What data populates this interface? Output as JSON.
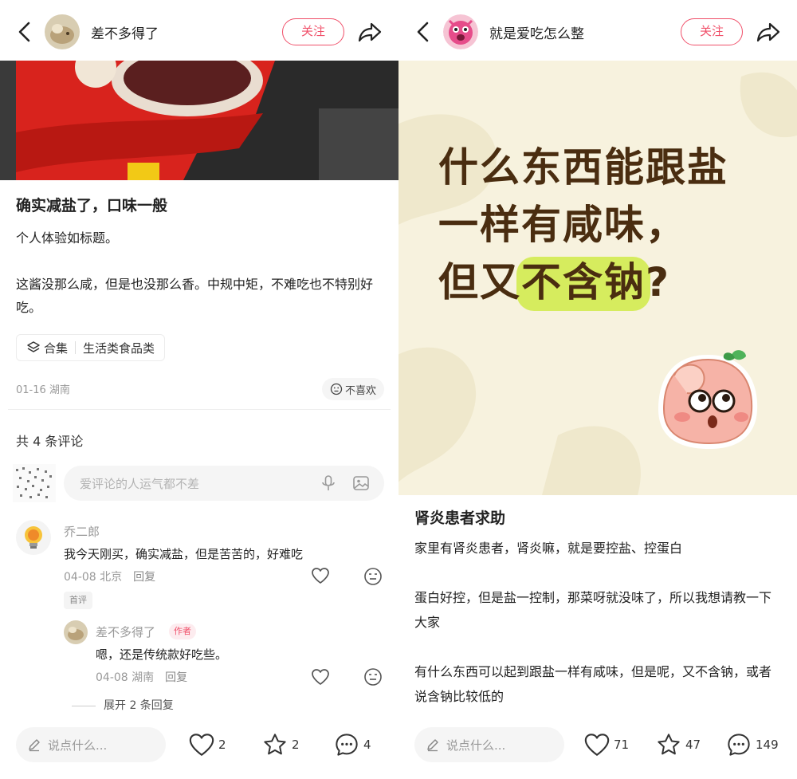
{
  "left": {
    "author": {
      "name": "差不多得了",
      "follow": "关注"
    },
    "post": {
      "title": "确实减盐了，口味一般",
      "body": "个人体验如标题。\n\n这酱没那么咸，但是也没那么香。中规中矩，不难吃也不特别好吃。",
      "collection_label": "合集",
      "collection_name": "生活类食品类",
      "date_location": "01-16 湖南",
      "dislike": "不喜欢"
    },
    "comments_header": "共 4 条评论",
    "comment_input_placeholder": "爱评论的人运气都不差",
    "comments": [
      {
        "author": "乔二郎",
        "text": "我今天刚买，确实减盐，但是苦苦的，好难吃",
        "meta": "04-08 北京",
        "reply": "回复",
        "badge": "首评"
      },
      {
        "author": "差不多得了",
        "author_tag": "作者",
        "text": "嗯，还是传统款好吃些。",
        "meta": "04-08 湖南",
        "reply": "回复"
      }
    ],
    "expand_replies": "展开 2 条回复",
    "bottom": {
      "say_placeholder": "说点什么...",
      "likes": "2",
      "stars": "2",
      "comments": "4"
    }
  },
  "right": {
    "author": {
      "name": "就是爱吃怎么整",
      "follow": "关注"
    },
    "poster": {
      "line1": "什么东西能跟盐",
      "line2": "一样有咸味，",
      "line3_pre": "但又",
      "line3_highlight": "不含钠",
      "line3_post": "?"
    },
    "post": {
      "title": "肾炎患者求助",
      "body": "家里有肾炎患者，肾炎嘛，就是要控盐、控蛋白\n\n蛋白好控，但是盐一控制，那菜呀就没味了，所以我想请教一下大家\n\n有什么东西可以起到跟盐一样有咸味，但是呢，又不含钠，或者说含钠比较低的"
    },
    "bottom": {
      "say_placeholder": "说点什么...",
      "likes": "71",
      "stars": "47",
      "comments": "149"
    }
  },
  "colors": {
    "accent": "#f0506a",
    "poster_bg": "#f7f2de",
    "poster_text": "#4a2d10",
    "highlight": "#d6ec5e"
  },
  "icons": [
    "back-icon",
    "share-icon",
    "layers-icon",
    "neutral-face-icon",
    "mic-icon",
    "image-icon",
    "heart-icon",
    "star-icon",
    "comment-icon",
    "pen-icon"
  ]
}
